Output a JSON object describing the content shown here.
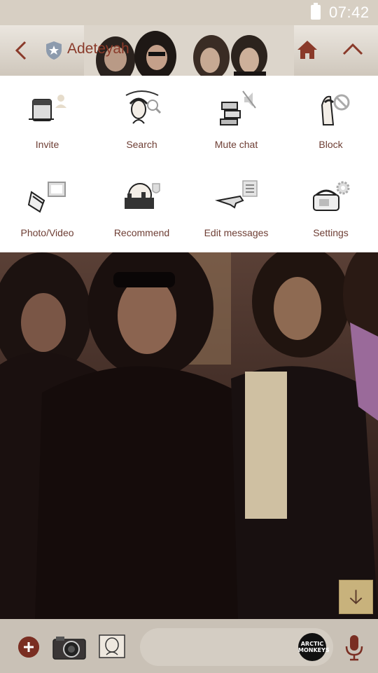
{
  "status_bar": {
    "time": "07:42"
  },
  "header": {
    "title": "Adeteyah"
  },
  "menu": {
    "items": [
      {
        "label": "Invite",
        "icon": "invite-icon"
      },
      {
        "label": "Search",
        "icon": "search-icon"
      },
      {
        "label": "Mute chat",
        "icon": "mute-icon"
      },
      {
        "label": "Block",
        "icon": "block-icon"
      },
      {
        "label": "Photo/Video",
        "icon": "photo-video-icon"
      },
      {
        "label": "Recommend",
        "icon": "recommend-icon"
      },
      {
        "label": "Edit messages",
        "icon": "edit-messages-icon"
      },
      {
        "label": "Settings",
        "icon": "settings-icon"
      }
    ]
  },
  "input": {
    "value": "",
    "placeholder": ""
  },
  "emoji_badge": {
    "line1": "ARCTIC",
    "line2": "MONKEYS"
  },
  "colors": {
    "accent": "#8a3a2a",
    "menu_text": "#6e3e34",
    "status_bar": "#d7cfc3",
    "input_bar": "#c9c1b6"
  }
}
